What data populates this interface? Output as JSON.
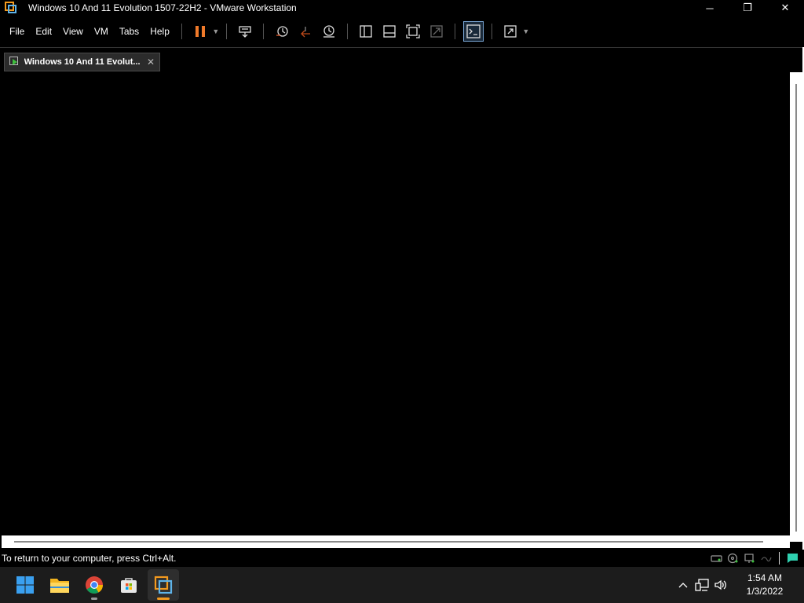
{
  "window": {
    "title": "Windows 10 And 11 Evolution 1507-22H2 - VMware Workstation",
    "minimize_glyph": "─",
    "restore_glyph": "❐",
    "close_glyph": "✕"
  },
  "menu": {
    "items": [
      "File",
      "Edit",
      "View",
      "VM",
      "Tabs",
      "Help"
    ]
  },
  "toolbar": {
    "icons": [
      "pause-icon",
      "send-ctrl-alt-del-icon",
      "snapshot-icon",
      "revert-snapshot-icon",
      "snapshot-manager-icon",
      "show-library-icon",
      "thumbnail-bar-icon",
      "full-screen-icon",
      "unity-icon",
      "console-view-icon",
      "stretch-guest-icon"
    ],
    "colors": {
      "pause": "#f07a2a",
      "active_border": "#7aa7d6"
    }
  },
  "tab": {
    "label": "Windows 10 And 11 Evolut...",
    "close_glyph": "✕"
  },
  "status": {
    "text": "To return to your computer, press Ctrl+Alt.",
    "icons": [
      "hard-disk-icon",
      "cd-dvd-icon",
      "network-adapter-icon",
      "usb-icon",
      "message-log-icon"
    ]
  },
  "taskbar": {
    "apps": [
      "start-icon",
      "file-explorer-icon",
      "chrome-icon",
      "microsoft-store-icon",
      "vmware-workstation-icon"
    ],
    "tray_icons": [
      "show-hidden-icons-icon",
      "network-icon",
      "volume-icon"
    ],
    "time": "1:54 AM",
    "date": "1/3/2022"
  }
}
